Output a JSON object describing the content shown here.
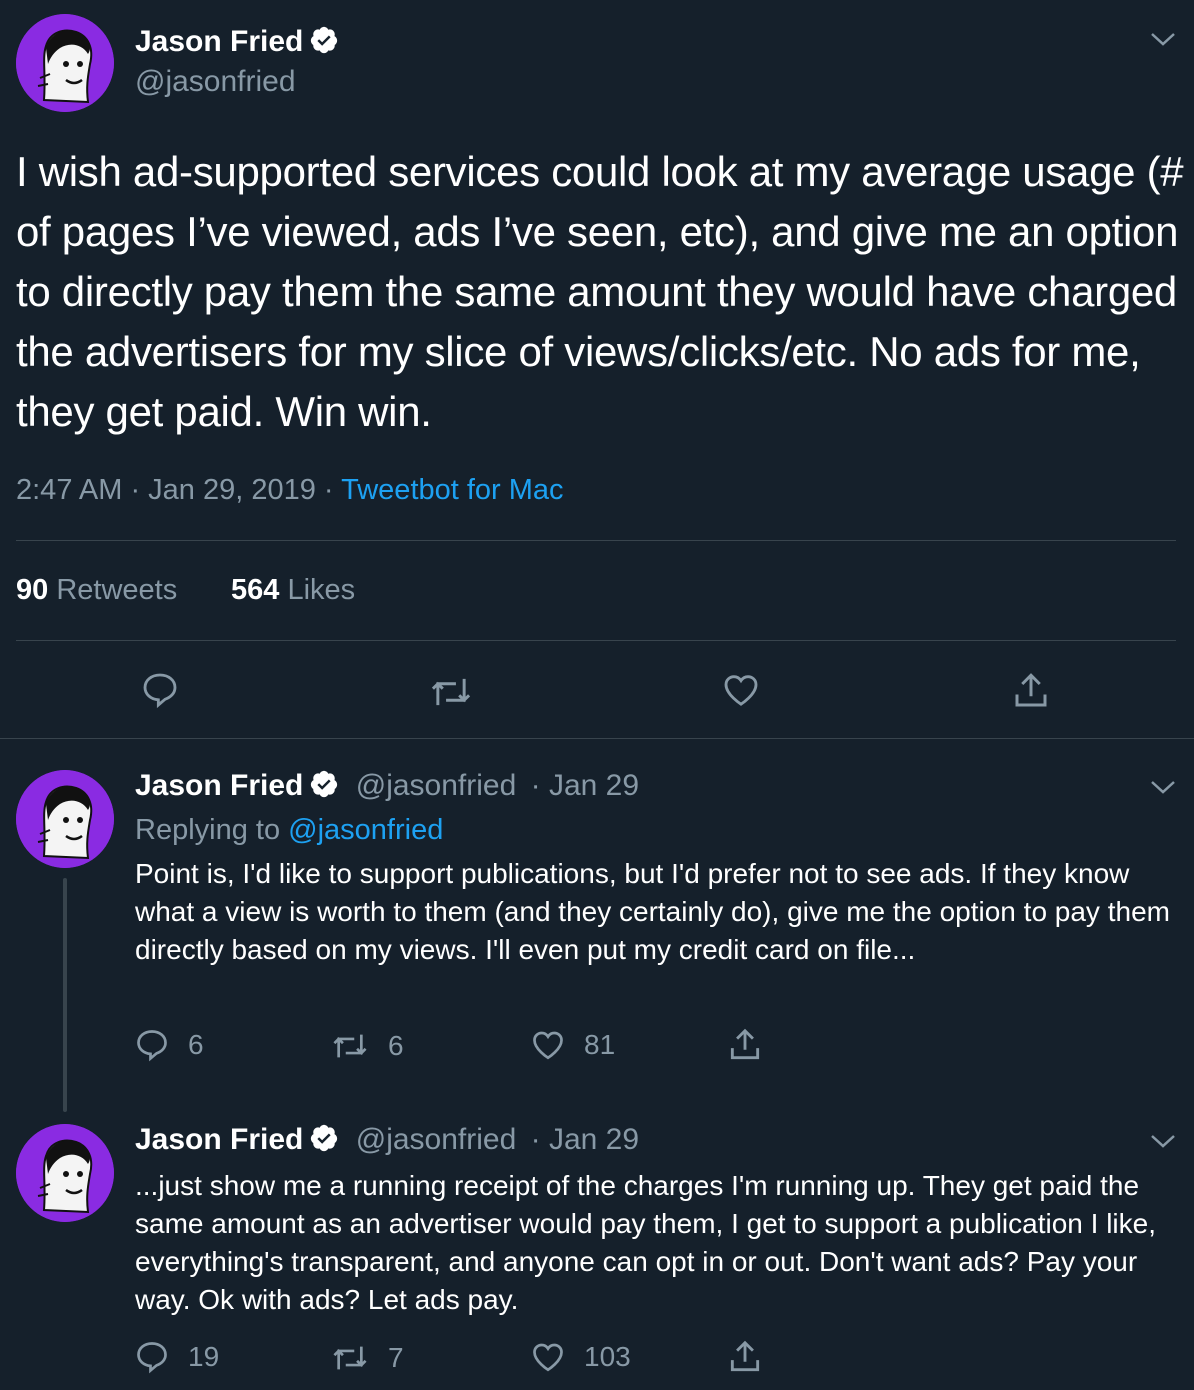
{
  "main_tweet": {
    "author_name": "Jason Fried",
    "handle": "@jasonfried",
    "text": "I wish ad-supported services could look at my average usage (# of pages I’ve viewed, ads I’ve seen, etc), and give me an option to directly pay them the same amount they would have charged the advertisers for my slice of views/clicks/etc. No ads for me, they get paid. Win win.",
    "time": "2:47 AM · Jan 29, 2019 · ",
    "source": "Tweetbot for Mac",
    "retweets_count": "90",
    "retweets_label": "Retweets",
    "likes_count": "564",
    "likes_label": "Likes"
  },
  "replies": [
    {
      "author_name": "Jason Fried",
      "handle": "@jasonfried",
      "date": "· Jan 29",
      "replying_prefix": "Replying to ",
      "replying_to": "@jasonfried",
      "text": "Point is, I'd like to support publications, but I'd prefer not to see ads. If they know what a view is worth to them (and they certainly do), give me the option to pay them directly based on my views. I'll even put my credit card on file...",
      "replies": "6",
      "retweets": "6",
      "likes": "81"
    },
    {
      "author_name": "Jason Fried",
      "handle": "@jasonfried",
      "date": "· Jan 29",
      "text": "...just show me a running receipt of the charges I'm running up. They get paid the same amount as an advertiser would pay them, I get to support a publication I like, everything's transparent, and anyone can opt in or out. Don't want ads? Pay your way. Ok with ads? Let ads pay.",
      "replies": "19",
      "retweets": "7",
      "likes": "103"
    }
  ],
  "icons": {
    "reply": "reply-icon",
    "retweet": "retweet-icon",
    "like": "heart-icon",
    "share": "share-icon",
    "verified": "verified-badge-icon",
    "more": "chevron-down-icon"
  },
  "colors": {
    "background": "#15202b",
    "text": "#ffffff",
    "secondary": "#8899a6",
    "link": "#1da1f2",
    "divider": "#38444d",
    "avatar_bg": "#8a2be2"
  }
}
